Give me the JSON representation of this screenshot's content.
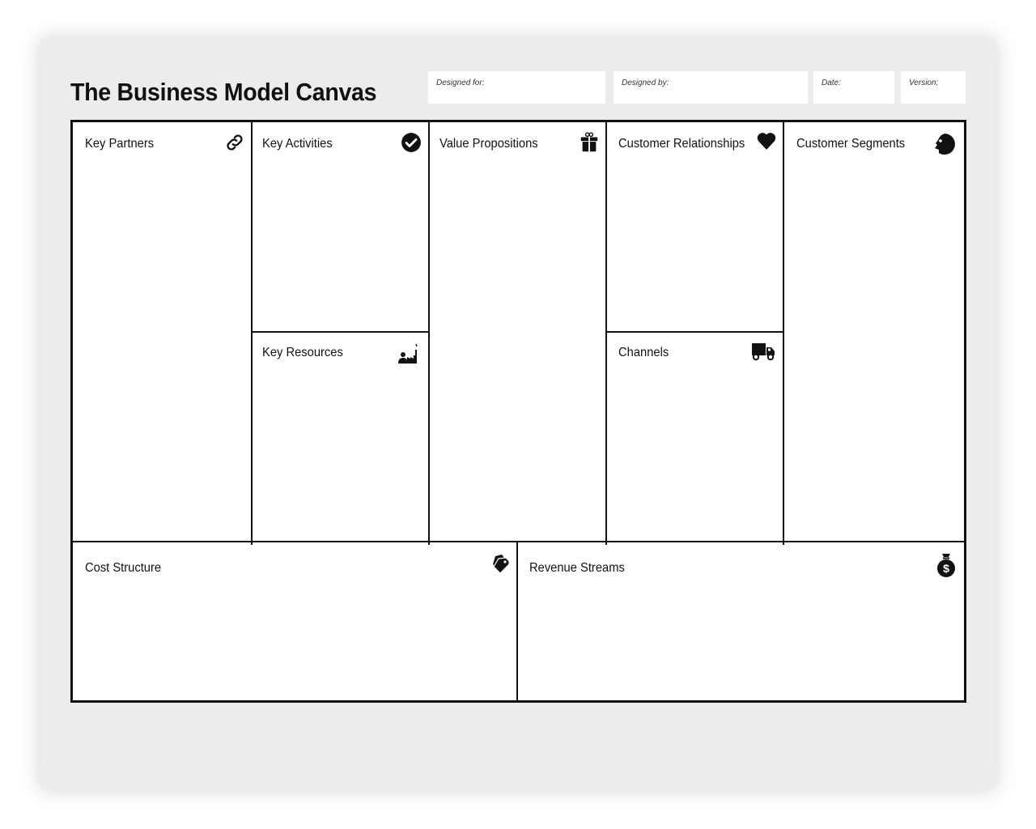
{
  "header": {
    "title": "The Business Model Canvas",
    "fields": [
      {
        "label": "Designed for:",
        "value": ""
      },
      {
        "label": "Designed by:",
        "value": ""
      },
      {
        "label": "Date:",
        "value": ""
      },
      {
        "label": "Version:",
        "value": ""
      }
    ]
  },
  "blocks": {
    "key_partners": {
      "label": "Key Partners",
      "icon": "link-icon"
    },
    "key_activities": {
      "label": "Key Activities",
      "icon": "checkmark-circle-icon"
    },
    "key_resources": {
      "label": "Key Resources",
      "icon": "person-factory-icon"
    },
    "value_propositions": {
      "label": "Value Propositions",
      "icon": "gift-icon"
    },
    "customer_relationships": {
      "label": "Customer Relationships",
      "icon": "heart-icon"
    },
    "channels": {
      "label": "Channels",
      "icon": "truck-icon"
    },
    "customer_segments": {
      "label": "Customer Segments",
      "icon": "face-icon"
    },
    "cost_structure": {
      "label": "Cost Structure",
      "icon": "price-tag-icon"
    },
    "revenue_streams": {
      "label": "Revenue Streams",
      "icon": "money-bag-icon"
    }
  },
  "colors": {
    "line": "#111111",
    "background": "#ececec",
    "panel": "#ffffff"
  }
}
